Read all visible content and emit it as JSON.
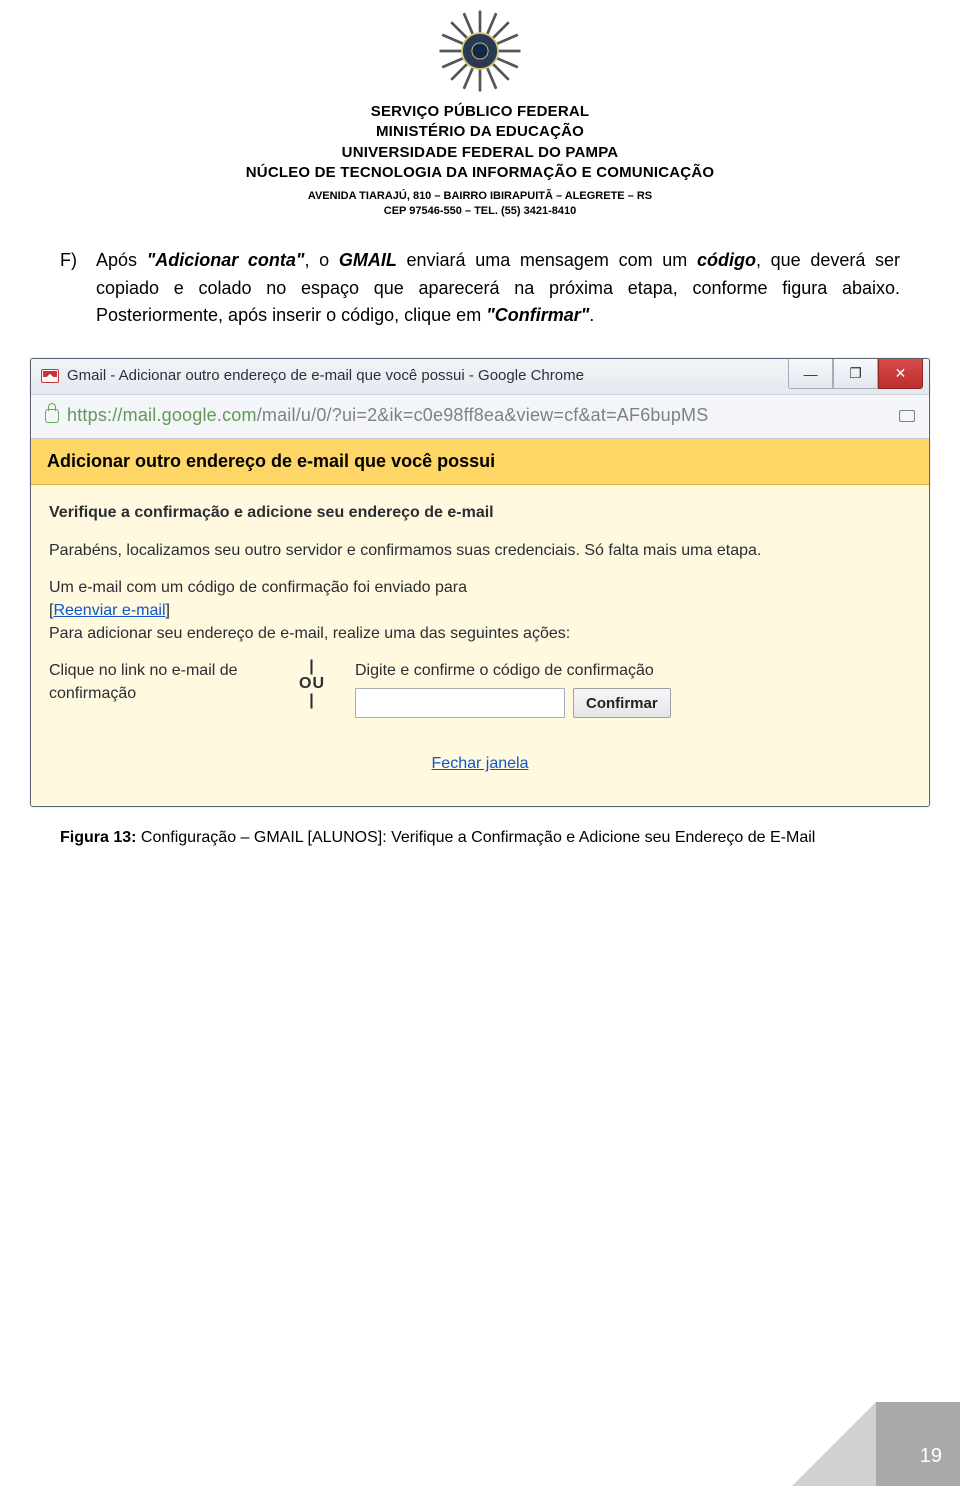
{
  "header": {
    "line1": "SERVIÇO PÚBLICO FEDERAL",
    "line2": "MINISTÉRIO DA EDUCAÇÃO",
    "line3": "UNIVERSIDADE FEDERAL DO PAMPA",
    "line4": "NÚCLEO DE TECNOLOGIA DA INFORMAÇÃO E COMUNICAÇÃO",
    "sub1": "AVENIDA TIARAJÚ, 810 – BAIRRO IBIRAPUITÃ – ALEGRETE – RS",
    "sub2": "CEP 97546-550 – TEL. (55) 3421-8410"
  },
  "body": {
    "marker": "F)",
    "p1_a": "Após ",
    "p1_b": "\"Adicionar conta\"",
    "p1_c": ", o ",
    "p1_d": "GMAIL",
    "p1_e": " enviará uma mensagem com um ",
    "p1_f": "código",
    "p1_g": ", que deverá ser copiado e colado no espaço que aparecerá na próxima etapa, conforme figura abaixo. Posteriormente, após inserir o código, clique em ",
    "p1_h": "\"Confirmar\"",
    "p1_i": "."
  },
  "window": {
    "title": "Gmail - Adicionar outro endereço de e-mail que você possui - Google Chrome",
    "min": "—",
    "max": "❐",
    "close": "✕",
    "url_secure": "https://mail.google.com",
    "url_rest": "/mail/u/0/?ui=2&ik=c0e98ff8ea&view=cf&at=AF6bupMS",
    "band": "Adicionar outro endereço de e-mail que você possui",
    "verify_title": "Verifique a confirmação e adicione seu endereço de e-mail",
    "p_congrats": "Parabéns, localizamos seu outro servidor e confirmamos suas credenciais. Só falta mais uma etapa.",
    "p_sent": "Um e-mail com um código de confirmação foi enviado para",
    "resend": "Reenviar e-mail",
    "p_actions": "Para adicionar seu endereço de e-mail, realize uma das seguintes ações:",
    "left_opt": "Clique no link no e-mail de confirmação",
    "ou_a": "|",
    "ou_b": "OU",
    "ou_c": "|",
    "right_lbl": "Digite e confirme o código de confirmação",
    "confirm_btn": "Confirmar",
    "close_link": "Fechar janela"
  },
  "caption": {
    "b": "Figura 13:",
    "rest": " Configuração – GMAIL [ALUNOS]: Verifique a Confirmação e Adicione seu Endereço de E-Mail"
  },
  "page_number": "19"
}
